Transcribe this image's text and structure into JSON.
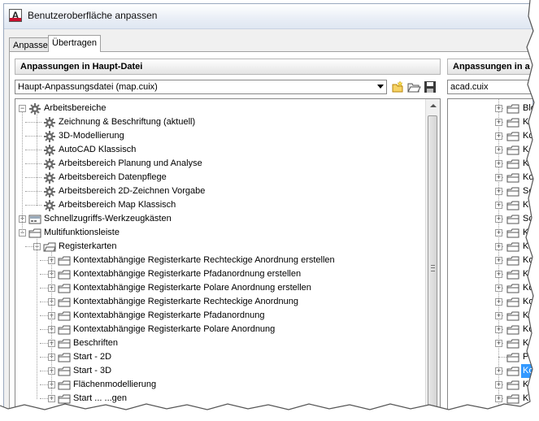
{
  "window": {
    "title": "Benutzeroberfläche anpassen",
    "icon": "autocad-app-icon"
  },
  "tabs": [
    {
      "label": "Anpassen",
      "active": false
    },
    {
      "label": "Übertragen",
      "active": true
    }
  ],
  "left_panel": {
    "header": "Anpassungen in Haupt-Datei",
    "combo_value": "Haupt-Anpassungsdatei (map.cuix)",
    "toolbar": [
      "open-new-icon",
      "open-folder-icon",
      "save-icon"
    ],
    "tree": [
      {
        "label": "Arbeitsbereiche",
        "level": 0,
        "expander": "minus",
        "icon": "workspace-gear-icon"
      },
      {
        "label": "Zeichnung & Beschriftung (aktuell)",
        "level": 1,
        "expander": "none",
        "icon": "workspace-gear-icon"
      },
      {
        "label": "3D-Modellierung",
        "level": 1,
        "expander": "none",
        "icon": "workspace-gear-icon"
      },
      {
        "label": "AutoCAD Klassisch",
        "level": 1,
        "expander": "none",
        "icon": "workspace-gear-icon"
      },
      {
        "label": "Arbeitsbereich Planung und Analyse",
        "level": 1,
        "expander": "none",
        "icon": "workspace-gear-icon"
      },
      {
        "label": "Arbeitsbereich Datenpflege",
        "level": 1,
        "expander": "none",
        "icon": "workspace-gear-icon"
      },
      {
        "label": "Arbeitsbereich 2D-Zeichnen Vorgabe",
        "level": 1,
        "expander": "none",
        "icon": "workspace-gear-icon"
      },
      {
        "label": "Arbeitsbereich Map Klassisch",
        "level": 1,
        "expander": "none",
        "icon": "workspace-gear-icon"
      },
      {
        "label": "Schnellzugriffs-Werkzeugkästen",
        "level": 0,
        "expander": "plus",
        "icon": "toolbar-icon"
      },
      {
        "label": "Multifunktionsleiste",
        "level": 0,
        "expander": "minus",
        "icon": "ribbon-icon"
      },
      {
        "label": "Registerkarten",
        "level": 1,
        "expander": "minus",
        "icon": "ribbon-tab-folder-icon"
      },
      {
        "label": "Kontextabhängige Registerkarte Rechteckige Anordnung erstellen",
        "level": 2,
        "expander": "plus",
        "icon": "ribbon-tab-icon"
      },
      {
        "label": "Kontextabhängige Registerkarte Pfadanordnung erstellen",
        "level": 2,
        "expander": "plus",
        "icon": "ribbon-tab-icon"
      },
      {
        "label": "Kontextabhängige Registerkarte Polare Anordnung erstellen",
        "level": 2,
        "expander": "plus",
        "icon": "ribbon-tab-icon"
      },
      {
        "label": "Kontextabhängige Registerkarte Rechteckige Anordnung",
        "level": 2,
        "expander": "plus",
        "icon": "ribbon-tab-icon"
      },
      {
        "label": "Kontextabhängige Registerkarte Pfadanordnung",
        "level": 2,
        "expander": "plus",
        "icon": "ribbon-tab-icon"
      },
      {
        "label": "Kontextabhängige Registerkarte Polare Anordnung",
        "level": 2,
        "expander": "plus",
        "icon": "ribbon-tab-icon"
      },
      {
        "label": "Beschriften",
        "level": 2,
        "expander": "plus",
        "icon": "ribbon-tab-icon"
      },
      {
        "label": "Start - 2D",
        "level": 2,
        "expander": "plus",
        "icon": "ribbon-tab-icon"
      },
      {
        "label": "Start - 3D",
        "level": 2,
        "expander": "plus",
        "icon": "ribbon-tab-icon"
      },
      {
        "label": "Flächenmodellierung",
        "level": 2,
        "expander": "plus",
        "icon": "ribbon-tab-icon"
      },
      {
        "label": "Start ... ...gen",
        "level": 2,
        "expander": "plus",
        "icon": "ribbon-tab-icon"
      }
    ]
  },
  "right_panel": {
    "header": "Anpassungen in a",
    "combo_value": "acad.cuix",
    "tree": [
      {
        "label": "Block",
        "expander": "plus",
        "highlight": false
      },
      {
        "label": "Kont",
        "expander": "plus",
        "highlight": false
      },
      {
        "label": "Kontex",
        "expander": "plus",
        "highlight": false
      },
      {
        "label": "Kont",
        "expander": "plus",
        "highlight": false
      },
      {
        "label": "Konte",
        "expander": "plus",
        "highlight": false
      },
      {
        "label": "Konte",
        "expander": "plus",
        "highlight": false
      },
      {
        "label": "Schraf",
        "expander": "plus",
        "highlight": false
      },
      {
        "label": "Ko",
        "expander": "plus",
        "highlight": false
      },
      {
        "label": "Schre",
        "expander": "plus",
        "highlight": false
      },
      {
        "label": "Kon",
        "expander": "plus",
        "highlight": false
      },
      {
        "label": "Kon",
        "expander": "plus",
        "highlight": false
      },
      {
        "label": "Konte",
        "expander": "plus",
        "highlight": false
      },
      {
        "label": "Konte",
        "expander": "plus",
        "highlight": false
      },
      {
        "label": "Kontex",
        "expander": "plus",
        "highlight": false
      },
      {
        "label": "Kont",
        "expander": "plus",
        "highlight": false
      },
      {
        "label": "Kont",
        "expander": "plus",
        "highlight": false
      },
      {
        "label": "Kont",
        "expander": "plus",
        "highlight": false
      },
      {
        "label": "Ko",
        "expander": "plus",
        "highlight": false
      },
      {
        "label": "Plugin",
        "expander": "none",
        "highlight": false
      },
      {
        "label": "Konte",
        "expander": "plus",
        "highlight": true
      },
      {
        "label": "Kon",
        "expander": "plus",
        "highlight": false
      },
      {
        "label": "Ko",
        "expander": "plus",
        "highlight": false
      }
    ]
  },
  "colors": {
    "selection": "#3399ff",
    "tree_lines": "#a0a0a0",
    "window_border": "#9aa9bf"
  }
}
